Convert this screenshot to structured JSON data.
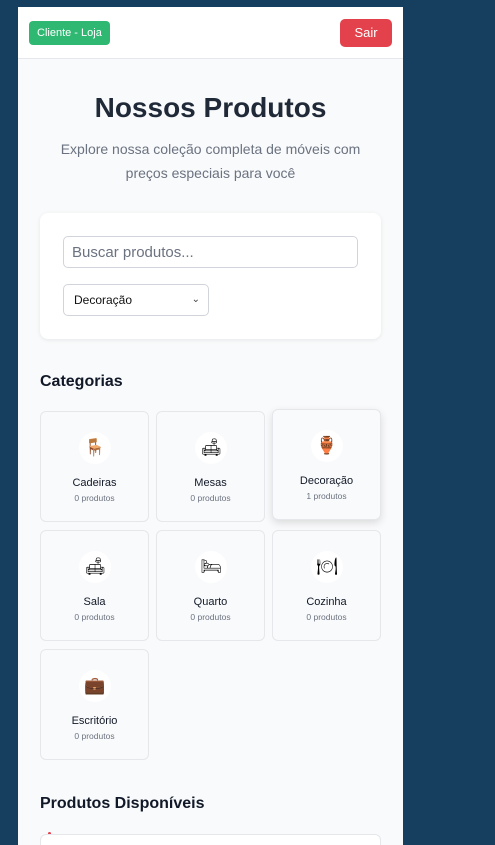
{
  "header": {
    "brand_label": "Cliente - Loja",
    "logout_label": "Sair"
  },
  "hero": {
    "title": "Nossos Produtos",
    "subtitle": "Explore nossa coleção completa de móveis com preços especiais para você"
  },
  "filters": {
    "search_placeholder": "Buscar produtos...",
    "category_selected": "Decoração"
  },
  "categories": {
    "title": "Categorias",
    "items": [
      {
        "name": "Cadeiras",
        "count": "0 produtos",
        "icon": "chair-icon",
        "glyph": "🪑"
      },
      {
        "name": "Mesas",
        "count": "0 produtos",
        "icon": "table-icon",
        "glyph": "🛋"
      },
      {
        "name": "Decoração",
        "count": "1 produtos",
        "icon": "vase-icon",
        "glyph": "🏺"
      },
      {
        "name": "Sala",
        "count": "0 produtos",
        "icon": "sofa-icon",
        "glyph": "🛋"
      },
      {
        "name": "Quarto",
        "count": "0 produtos",
        "icon": "bed-icon",
        "glyph": "🛏"
      },
      {
        "name": "Cozinha",
        "count": "0 produtos",
        "icon": "plate-icon",
        "glyph": "🍽"
      },
      {
        "name": "Escritório",
        "count": "0 produtos",
        "icon": "briefcase-icon",
        "glyph": "💼"
      }
    ]
  },
  "products": {
    "title": "Produtos Disponíveis"
  },
  "colors": {
    "brand": "#2fb872",
    "danger": "#e3414c",
    "background": "#163f5f"
  }
}
